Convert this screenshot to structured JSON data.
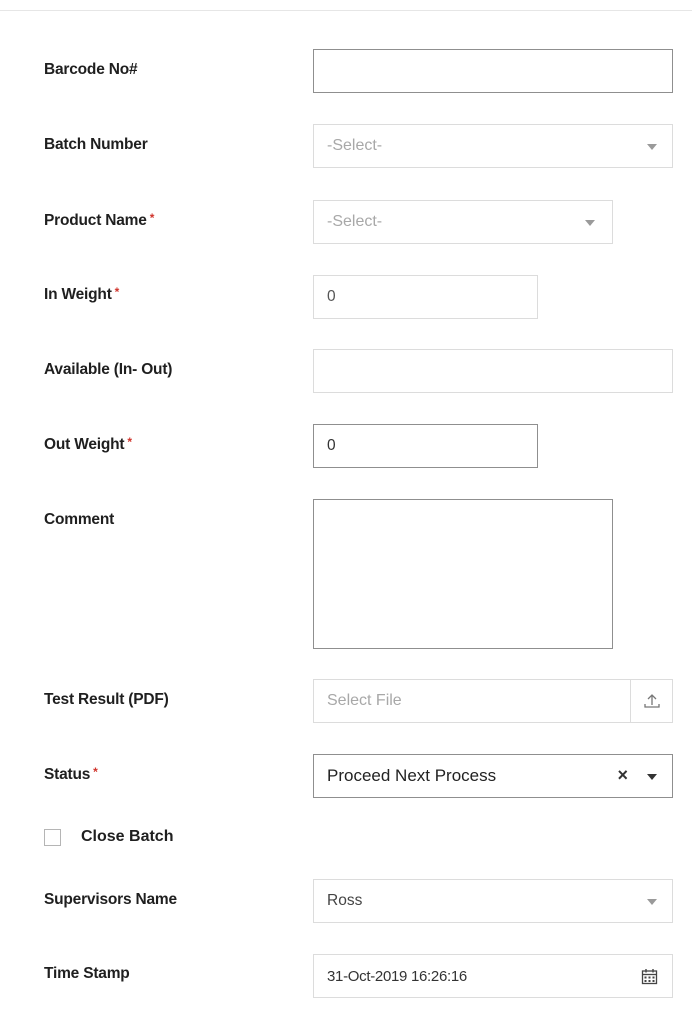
{
  "form": {
    "barcode": {
      "label": "Barcode No#",
      "value": ""
    },
    "batch_number": {
      "label": "Batch Number",
      "placeholder": "-Select-"
    },
    "product_name": {
      "label": "Product Name",
      "required": "*",
      "placeholder": "-Select-"
    },
    "in_weight": {
      "label": "In Weight",
      "required": "*",
      "value": "0"
    },
    "available": {
      "label": "Available (In- Out)",
      "value": ""
    },
    "out_weight": {
      "label": "Out Weight",
      "required": "*",
      "value": "0"
    },
    "comment": {
      "label": "Comment",
      "value": ""
    },
    "test_result": {
      "label": "Test Result (PDF)",
      "placeholder": "Select File"
    },
    "status": {
      "label": "Status",
      "required": "*",
      "value": "Proceed Next Process",
      "clear_symbol": "×"
    },
    "close_batch": {
      "label": "Close Batch",
      "checked": false
    },
    "supervisor": {
      "label": "Supervisors Name",
      "value": "Ross"
    },
    "timestamp": {
      "label": "Time Stamp",
      "value": "31-Oct-2019 16:26:16"
    }
  },
  "icons": {
    "dropdown": "chevron-down-icon",
    "upload": "upload-icon",
    "calendar": "calendar-icon",
    "clear": "clear-icon"
  },
  "colors": {
    "required": "#d0342c",
    "border": "#dcdcdc",
    "border_active": "#8f8f8f",
    "placeholder": "#a8a8a8"
  }
}
